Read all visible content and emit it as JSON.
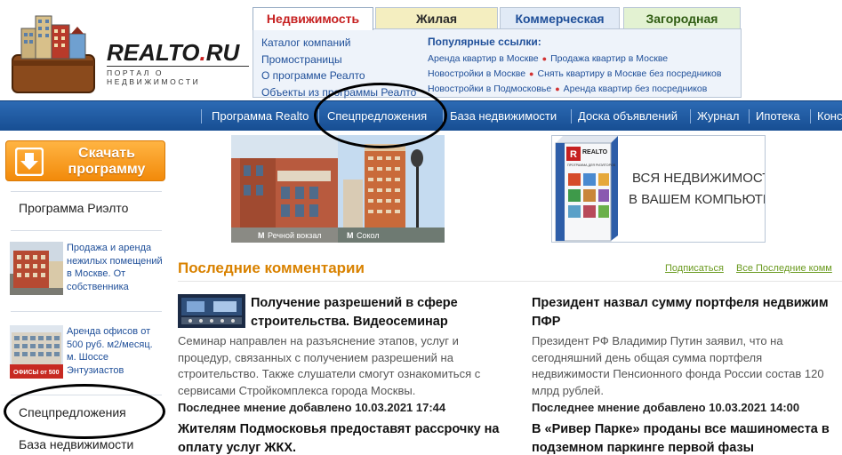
{
  "logo": {
    "name_main": "REALTO",
    "name_dot": ".",
    "name_tld": "RU",
    "tagline": "ПОРТАЛ О НЕДВИЖИМОСТИ"
  },
  "tabs": [
    {
      "label": "Недвижимость",
      "active": true
    },
    {
      "label": "Жилая",
      "active": false
    },
    {
      "label": "Коммерческая",
      "active": false
    },
    {
      "label": "Загородная",
      "active": false
    }
  ],
  "catalog_links": [
    "Каталог компаний",
    "Промостраницы",
    "О программе Реалто",
    "Объекты из программы Реалто"
  ],
  "popular": {
    "title": "Популярные ссылки:",
    "rows": [
      [
        "Аренда квартир в Москве",
        "Продажа квартир в Москве"
      ],
      [
        "Новостройки в Москве",
        "Снять квартиру в Москве без посредников"
      ],
      [
        "Новостройки в Подмосковье",
        "Аренда квартир без посредников"
      ]
    ]
  },
  "nav": [
    "Программа Realto",
    "Спецпредложения",
    "База недвижимости",
    "Доска объявлений",
    "Журнал",
    "Ипотека",
    "Конс"
  ],
  "sidebar": {
    "download_line1": "Скачать",
    "download_line2": "программу",
    "program": "Программа Риэлто",
    "promo1": "Продажа и аренда нежилых помещений в Москве. От собственника",
    "promo2": "Аренда офисов от 500 руб. м2/месяц. м. Шоссе Энтузиастов",
    "promo2_sign": "ОФИСЫ от 500",
    "special": "Спецпредложения",
    "base": "База недвижимости"
  },
  "banner1": {
    "metro1": "Речной вокзал",
    "metro2": "Сокол"
  },
  "banner2": {
    "line1": "ВСЯ НЕДВИЖИМОСТЬ",
    "line2": "В ВАШЕМ КОМПЬЮТЕРЕ",
    "box_brand": "REALTO",
    "box_sub": "ПРОГРАММА ДЛЯ РИЭЛТОРОВ"
  },
  "comments": {
    "title": "Последние комментарии",
    "subscribe": "Подписаться",
    "all": "Все Последние комм",
    "items": [
      {
        "title": "Получение разрешений в сфере строительства. Видеосеминар",
        "desc": "Семинар направлен на разъяснение этапов, услуг и процедур, связанных с получением разрешений на строительство. Также слушатели смогут ознакомиться с сервисами Стройкомплекса города Москвы.",
        "meta": "Последнее мнение добавлено 10.03.2021 17:44"
      },
      {
        "title": "Президент назвал сумму портфеля недвижим ПФР",
        "desc": "Президент РФ Владимир Путин заявил, что на сегодняшний день общая сумма портфеля недвижимости Пенсионного фонда России состав 120 млрд рублей.",
        "meta": "Последнее мнение добавлено 10.03.2021 14:00"
      },
      {
        "title": "Жителям Подмосковья предоставят рассрочку на оплату услуг ЖКХ."
      },
      {
        "title": "В «Ривер Парке» проданы все машиноместа в подземном паркинге первой фазы"
      }
    ]
  },
  "colors": {
    "nav_blue": "#1f5ba3",
    "accent_orange": "#d98200",
    "tab_active_red": "#c62020",
    "link_blue": "#1f4f99"
  }
}
